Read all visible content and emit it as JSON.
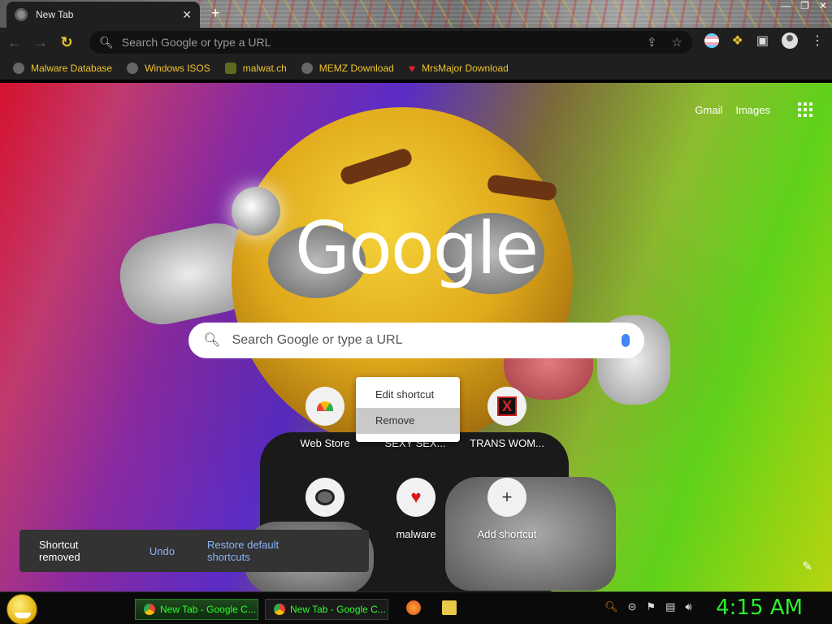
{
  "window": {
    "tab_title": "New Tab",
    "tab_close": "✕",
    "new_tab": "+",
    "controls": [
      "—",
      "❐",
      "✕"
    ]
  },
  "toolbar": {
    "back": "←",
    "forward": "→",
    "reload": "↻",
    "omnibox_placeholder": "Search Google or type a URL",
    "share_icon": "⇪",
    "star_icon": "☆",
    "menu": "⋮"
  },
  "bookmarks": [
    {
      "label": "Malware Database",
      "icon": "globe-icon"
    },
    {
      "label": "Windows ISOS",
      "icon": "globe-icon"
    },
    {
      "label": "malwat.ch",
      "icon": "ghost-icon"
    },
    {
      "label": "MEMZ Download",
      "icon": "globe-icon"
    },
    {
      "label": "MrsMajor Download",
      "icon": "heart-icon"
    }
  ],
  "ntp": {
    "links": {
      "gmail": "Gmail",
      "images": "Images"
    },
    "logo": "Google",
    "search_placeholder": "Search Google or type a URL",
    "shortcuts": [
      {
        "label": "Web Store",
        "icon": "webstore-icon"
      },
      {
        "label": "SEXY SEX...",
        "icon": "hidden-under-menu"
      },
      {
        "label": "TRANS WOM...",
        "icon": "x-icon"
      },
      {
        "label": "",
        "icon": "raccoon-icon"
      },
      {
        "label": "malware",
        "icon": "heart-icon"
      },
      {
        "label": "Add shortcut",
        "icon": "plus-icon"
      }
    ],
    "context_menu": {
      "edit": "Edit shortcut",
      "remove": "Remove"
    },
    "toast": {
      "message": "Shortcut removed",
      "undo": "Undo",
      "restore": "Restore default shortcuts"
    },
    "customize_icon": "✎"
  },
  "taskbar": {
    "tasks": [
      "New Tab - Google C...",
      "New Tab - Google C..."
    ],
    "clock": "4:15 AM"
  },
  "colors": {
    "bookmark_text": "#f0c52b",
    "taskbar_text": "#2aff2a",
    "toast_link": "#8ab4f8"
  }
}
